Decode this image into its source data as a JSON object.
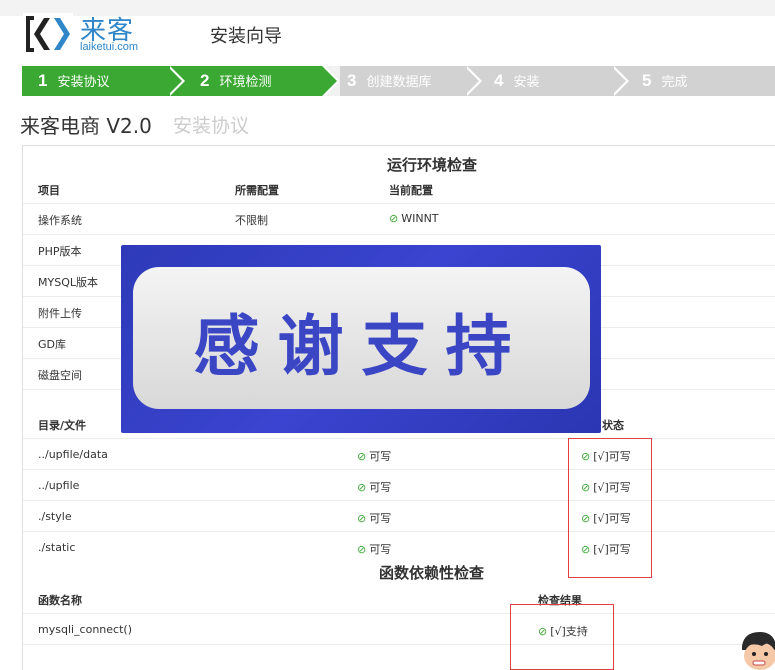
{
  "brand": {
    "name": "来客",
    "domain": "laiketui.com",
    "accent": "#2f86c8"
  },
  "header": {
    "title": "安装向导"
  },
  "steps": [
    {
      "num": "1",
      "label": "安装协议",
      "active": true
    },
    {
      "num": "2",
      "label": "环境检测",
      "active": true
    },
    {
      "num": "3",
      "label": "创建数据库",
      "active": false
    },
    {
      "num": "4",
      "label": "安装",
      "active": false
    },
    {
      "num": "5",
      "label": "完成",
      "active": false
    }
  ],
  "page": {
    "title": "来客电商 V2.0",
    "subtitle": "安装协议"
  },
  "env_check": {
    "title": "运行环境检查",
    "headers": [
      "项目",
      "所需配置",
      "当前配置"
    ],
    "rows": [
      {
        "item": "操作系统",
        "required": "不限制",
        "current": "WINNT"
      },
      {
        "item": "PHP版本",
        "required": "",
        "current": ""
      },
      {
        "item": "MYSQL版本",
        "required": "",
        "current": ""
      },
      {
        "item": "附件上传",
        "required": "",
        "current": ""
      },
      {
        "item": "GD库",
        "required": "",
        "current": ""
      },
      {
        "item": "磁盘空间",
        "required": "",
        "current": ""
      }
    ]
  },
  "dir_check": {
    "headers": {
      "path": "目录/文件",
      "status": "状态"
    },
    "rows": [
      {
        "path": "../upfile/data",
        "required": "可写",
        "status": "[√]可写"
      },
      {
        "path": "../upfile",
        "required": "可写",
        "status": "[√]可写"
      },
      {
        "path": "./style",
        "required": "可写",
        "status": "[√]可写"
      },
      {
        "path": "./static",
        "required": "可写",
        "status": "[√]可写"
      }
    ]
  },
  "func_check": {
    "title": "函数依赖性检查",
    "headers": [
      "函数名称",
      "检查结果"
    ],
    "rows": [
      {
        "name": "mysqli_connect()",
        "result": "[√]支持"
      },
      {
        "name": "",
        "result": ""
      }
    ]
  },
  "banner": {
    "text": "感谢支持"
  },
  "colors": {
    "success": "#3aa832",
    "step_active": "#3aa832",
    "step_inactive": "#d2d2d2",
    "highlight": "#e04040"
  },
  "icons": {
    "ok": "check-circle-icon"
  }
}
